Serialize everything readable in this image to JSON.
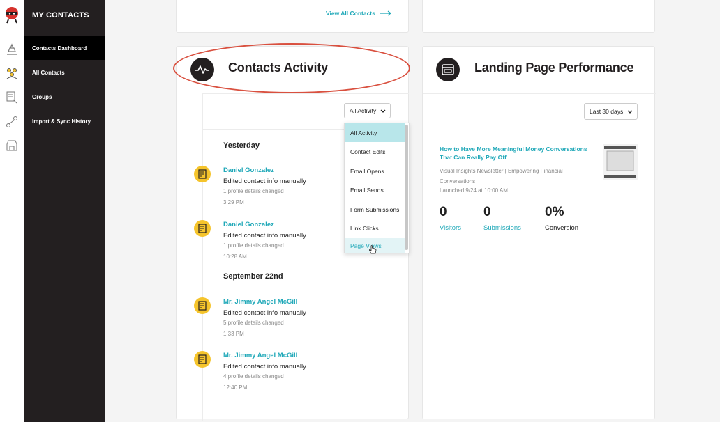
{
  "sidebar": {
    "title": "MY CONTACTS",
    "items": [
      {
        "label": "Contacts Dashboard"
      },
      {
        "label": "All Contacts"
      },
      {
        "label": "Groups"
      },
      {
        "label": "Import & Sync History"
      }
    ]
  },
  "top_card": {
    "view_all": "View All Contacts"
  },
  "activity": {
    "title": "Contacts Activity",
    "filter": "All Activity",
    "dropdown": [
      "All Activity",
      "Contact Edits",
      "Email Opens",
      "Email Sends",
      "Form Submissions",
      "Link Clicks",
      "Page Views"
    ],
    "groups": [
      {
        "day": "Yesterday",
        "entries": [
          {
            "name": "Daniel Gonzalez",
            "desc": "Edited contact info manually",
            "detail": "1 profile details changed",
            "time": "3:29 PM"
          },
          {
            "name": "Daniel Gonzalez",
            "desc": "Edited contact info manually",
            "detail": "1 profile details changed",
            "time": "10:28 AM"
          }
        ]
      },
      {
        "day": "September 22nd",
        "entries": [
          {
            "name": "Mr. Jimmy Angel McGill",
            "desc": "Edited contact info manually",
            "detail": "5 profile details changed",
            "time": "1:33 PM"
          },
          {
            "name": "Mr. Jimmy Angel McGill",
            "desc": "Edited contact info manually",
            "detail": "4 profile details changed",
            "time": "12:40 PM"
          }
        ]
      }
    ]
  },
  "landing": {
    "title": "Landing Page Performance",
    "range": "Last 30 days",
    "page_title_line1": "How to Have More Meaningful Money Conversations",
    "page_title_line2": "That Can Really Pay Off",
    "meta_line1": "Visual Insights Newsletter | Empowering Financial",
    "meta_line2": "Conversations",
    "launched": "Launched 9/24 at 10:00 AM",
    "stats": [
      {
        "value": "0",
        "label": "Visitors"
      },
      {
        "value": "0",
        "label": "Submissions"
      },
      {
        "value": "0%",
        "label": "Conversion"
      }
    ]
  },
  "colors": {
    "accent": "#1fa8b8",
    "sidebar": "#231f20",
    "activity_icon": "#f5c42c",
    "annotation": "#d9503f"
  }
}
